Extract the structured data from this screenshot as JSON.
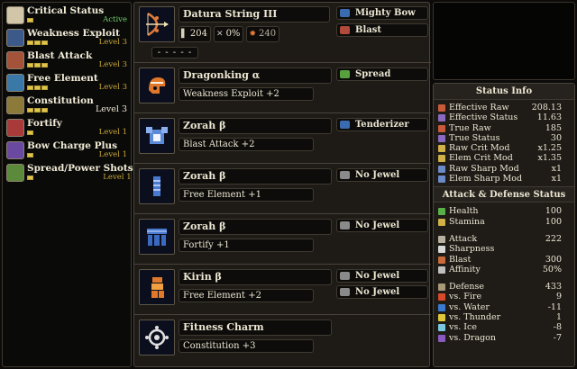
{
  "skills": [
    {
      "name": "Critical Status",
      "pips": 1,
      "max": 1,
      "level": "Active",
      "cls": "active",
      "color": "#d2c6a8"
    },
    {
      "name": "Weakness Exploit",
      "pips": 3,
      "max": 3,
      "level": "Level 3",
      "cls": "",
      "color": "#3b5a8a"
    },
    {
      "name": "Blast Attack",
      "pips": 3,
      "max": 3,
      "level": "Level 3",
      "cls": "",
      "color": "#a4523a"
    },
    {
      "name": "Free Element",
      "pips": 3,
      "max": 3,
      "level": "Level 3",
      "cls": "",
      "color": "#3a78a8"
    },
    {
      "name": "Constitution",
      "pips": 3,
      "max": 3,
      "level": "Level 3",
      "cls": "white",
      "color": "#8c7a3a"
    },
    {
      "name": "Fortify",
      "pips": 1,
      "max": 1,
      "level": "Level 1",
      "cls": "",
      "color": "#a83a3a"
    },
    {
      "name": "Bow Charge Plus",
      "pips": 1,
      "max": 1,
      "level": "Level 1",
      "cls": "",
      "color": "#6a4aa0"
    },
    {
      "name": "Spread/Power Shots",
      "pips": 1,
      "max": 1,
      "level": "Level 1",
      "cls": "",
      "color": "#5a8a3a"
    }
  ],
  "weapon": {
    "name": "Datura String III",
    "attack": "204",
    "affinity": "0%",
    "element": "240",
    "slots": "- - - - -",
    "deco1": "Mighty Bow",
    "deco2": "Blast"
  },
  "armor": [
    {
      "name": "Dragonking α",
      "skill": "Weakness Exploit +2",
      "decos": [
        "Spread"
      ],
      "deco_colors": [
        "#58a23e"
      ],
      "icon": "head"
    },
    {
      "name": "Zorah β",
      "skill": "Blast Attack +2",
      "decos": [
        "Tenderizer"
      ],
      "deco_colors": [
        "#3a6ab0"
      ],
      "icon": "chest"
    },
    {
      "name": "Zorah β",
      "skill": "Free Element +1",
      "decos": [
        "No Jewel"
      ],
      "deco_colors": [
        "#8a8a8a"
      ],
      "icon": "arms"
    },
    {
      "name": "Zorah β",
      "skill": "Fortify +1",
      "decos": [
        "No Jewel"
      ],
      "deco_colors": [
        "#8a8a8a"
      ],
      "icon": "waist"
    },
    {
      "name": "Kirin β",
      "skill": "Free Element +2",
      "decos": [
        "No Jewel",
        "No Jewel"
      ],
      "deco_colors": [
        "#8a8a8a",
        "#8a8a8a"
      ],
      "icon": "legs"
    },
    {
      "name": "Fitness Charm",
      "skill": "Constitution +3",
      "decos": [],
      "deco_colors": [],
      "icon": "charm"
    }
  ],
  "status": {
    "title": "Status Info",
    "rows": [
      {
        "label": "Effective Raw",
        "value": "208.13",
        "color": "#c85a3a"
      },
      {
        "label": "Effective Status",
        "value": "11.63",
        "color": "#8a6ac0"
      },
      {
        "label": "True Raw",
        "value": "185",
        "color": "#c85a3a"
      },
      {
        "label": "True Status",
        "value": "30",
        "color": "#8a6ac0"
      },
      {
        "label": "Raw Crit Mod",
        "value": "x1.25",
        "color": "#d0b048"
      },
      {
        "label": "Elem Crit Mod",
        "value": "x1.35",
        "color": "#d0b048"
      },
      {
        "label": "Raw Sharp Mod",
        "value": "x1",
        "color": "#6a8ac8"
      },
      {
        "label": "Elem Sharp Mod",
        "value": "x1",
        "color": "#6a8ac8"
      }
    ],
    "title2": "Attack & Defense Status",
    "rows2": [
      {
        "label": "Health",
        "value": "100",
        "color": "#58b048"
      },
      {
        "label": "Stamina",
        "value": "100",
        "color": "#d0b048"
      }
    ],
    "rows3": [
      {
        "label": "Attack",
        "value": "222",
        "color": "#b8b0a0"
      },
      {
        "label": "Sharpness",
        "value": "",
        "color": "#d8d8d8"
      },
      {
        "label": "Blast",
        "value": "300",
        "color": "#c86a3a"
      },
      {
        "label": "Affinity",
        "value": "50%",
        "color": "#c0c0c0"
      }
    ],
    "rows4": [
      {
        "label": "Defense",
        "value": "433",
        "color": "#a89a78"
      },
      {
        "label": "vs. Fire",
        "value": "9",
        "color": "#d84a2a"
      },
      {
        "label": "vs. Water",
        "value": "-11",
        "color": "#3a7ad0"
      },
      {
        "label": "vs. Thunder",
        "value": "1",
        "color": "#e0c83a"
      },
      {
        "label": "vs. Ice",
        "value": "-8",
        "color": "#7ac8e0"
      },
      {
        "label": "vs. Dragon",
        "value": "-7",
        "color": "#8a5ac0"
      }
    ]
  }
}
